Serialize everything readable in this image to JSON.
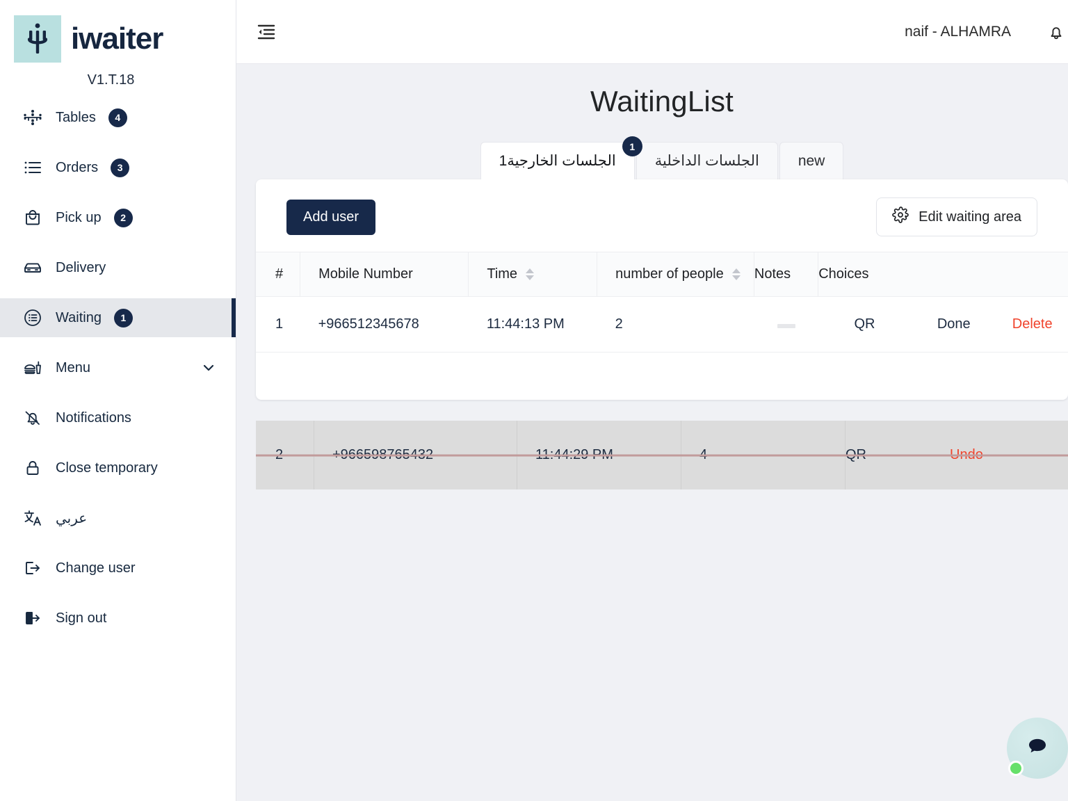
{
  "brand": {
    "name": "iwaiter",
    "version": "V1.T.18",
    "mark_color": "#b9e0e0",
    "accent": "#17294a"
  },
  "sidebar": {
    "items": [
      {
        "label": "Tables",
        "icon": "tables-icon",
        "badge": "4"
      },
      {
        "label": "Orders",
        "icon": "orders-list-icon",
        "badge": "3"
      },
      {
        "label": "Pick up",
        "icon": "bag-icon",
        "badge": "2"
      },
      {
        "label": "Delivery",
        "icon": "car-icon",
        "badge": ""
      },
      {
        "label": "Waiting",
        "icon": "waiting-circle-list-icon",
        "badge": "1"
      },
      {
        "label": "Menu",
        "icon": "burger-drink-icon",
        "badge": ""
      },
      {
        "label": "Notifications",
        "icon": "bell-off-icon",
        "badge": ""
      },
      {
        "label": "Close temporary",
        "icon": "lock-icon",
        "badge": ""
      },
      {
        "label": "عربي",
        "icon": "translate-icon",
        "badge": ""
      },
      {
        "label": "Change user",
        "icon": "logout-arrow-icon",
        "badge": ""
      },
      {
        "label": "Sign out",
        "icon": "signout-icon",
        "badge": ""
      }
    ]
  },
  "topbar": {
    "collapse_icon": "collapse-sidebar-icon",
    "user": "naif - ALHAMRA",
    "bell_icon": "bell-icon"
  },
  "page": {
    "title": "WaitingList"
  },
  "tabs": [
    {
      "label": "الجلسات الخارجية1",
      "badge": "1",
      "active": true,
      "rtl": true
    },
    {
      "label": "الجلسات الداخلية",
      "badge": "",
      "active": false,
      "rtl": true
    },
    {
      "label": "new",
      "badge": "",
      "active": false,
      "rtl": false
    }
  ],
  "toolbar": {
    "add_user_label": "Add user",
    "edit_area_label": "Edit waiting area",
    "gear_icon": "gear-icon"
  },
  "table": {
    "headers": {
      "hash": "#",
      "mobile": "Mobile Number",
      "time": "Time",
      "people": "number of people",
      "notes": "Notes",
      "choices": "Choices"
    },
    "rows": [
      {
        "index": "1",
        "mobile": "+966512345678",
        "time": "11:44:13 PM",
        "people": "2",
        "notes": "—",
        "choice": "QR",
        "action_primary": "Done",
        "action_danger": "Delete"
      }
    ]
  },
  "done_row": {
    "index": "2",
    "mobile": "+966598765432",
    "time": "11:44:29 PM",
    "people": "4",
    "notes": "",
    "choice": "QR",
    "action": "Undo",
    "strike_color": "#c19b9b",
    "bg_color": "#dcdcdc"
  },
  "chat": {
    "icon": "chat-bubble-icon",
    "status": "online",
    "status_color": "#66e06a"
  },
  "colors": {
    "accent": "#17294a",
    "danger": "#f0432c",
    "page_bg": "#f0f1f5"
  }
}
